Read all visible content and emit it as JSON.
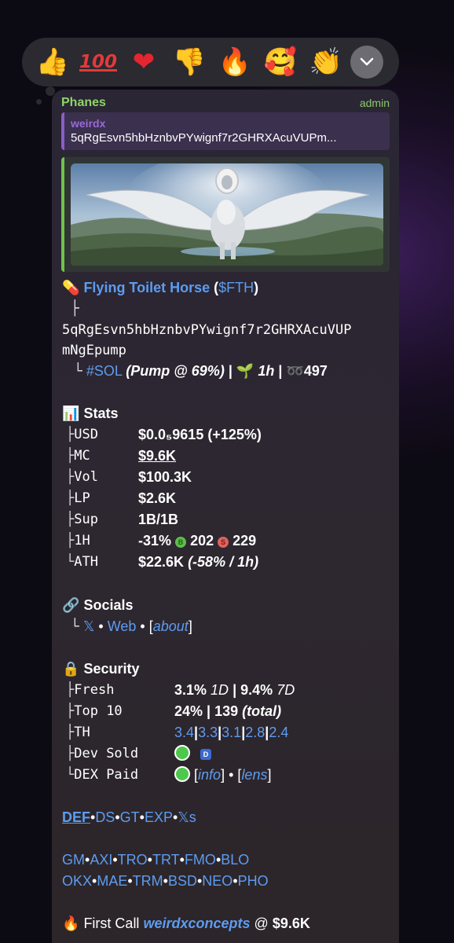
{
  "reactions": {
    "items": [
      {
        "icon": "thumbs-up-icon",
        "glyph": "👍"
      },
      {
        "icon": "hundred-points-icon",
        "glyph": "100"
      },
      {
        "icon": "red-heart-icon",
        "glyph": "❤"
      },
      {
        "icon": "thumbs-down-icon",
        "glyph": "👎"
      },
      {
        "icon": "fire-icon",
        "glyph": "🔥"
      },
      {
        "icon": "smiling-hearts-icon",
        "glyph": "🥰"
      },
      {
        "icon": "clapping-hands-icon",
        "glyph": "👏"
      }
    ]
  },
  "message": {
    "sender": "Phanes",
    "role": "admin",
    "reply": {
      "name": "weirdx",
      "text": "5qRgEsvn5hbHznbvPYwignf7r2GHRXAcuVUPm..."
    },
    "token": {
      "emoji": "💊",
      "name": "Flying Toilet Horse",
      "open_paren": "(",
      "ticker": "$FTH",
      "close_paren": ")",
      "tree_top": "├",
      "address_line1": "5qRgEsvn5hbHznbvPYwignf7r2GHRXAcuVUP",
      "address_line2": "mNgEpump",
      "tree_end": "└",
      "chain": "#SOL",
      "pump": "(Pump @ 69%)",
      "sep1": "|",
      "seedling": "🌱",
      "age": "1h",
      "sep2": "|",
      "holders_icon": "➿",
      "holders": "497"
    },
    "stats": {
      "emoji": "📊",
      "title": "Stats",
      "rows": [
        {
          "tree": "├",
          "label": "USD",
          "value": "$0.0₅9615 (+125%)"
        },
        {
          "tree": "├",
          "label": "MC",
          "value": "$9.6K"
        },
        {
          "tree": "├",
          "label": "Vol",
          "value": "$100.3K"
        },
        {
          "tree": "├",
          "label": "LP",
          "value": "$2.6K"
        },
        {
          "tree": "├",
          "label": "Sup",
          "value": "1B/1B"
        },
        {
          "tree": "├",
          "label": "1H",
          "value": "-31%",
          "buy_badge": "B",
          "buys": "202",
          "sell_badge": "S",
          "sells": "229"
        },
        {
          "tree": "└",
          "label": "ATH",
          "value": "$22.6K",
          "extra": "(-58% / 1h)"
        }
      ]
    },
    "socials": {
      "emoji": "🔗",
      "title": "Socials",
      "tree": "└",
      "x": "𝕏",
      "dot1": "•",
      "web": "Web",
      "dot2": "•",
      "about_open": "[",
      "about": "about",
      "about_close": "]"
    },
    "security": {
      "emoji": "🔒",
      "title": "Security",
      "fresh": {
        "tree": "├",
        "label": "Fresh",
        "p1": "3.1%",
        "t1": "1D",
        "sep": "|",
        "p2": "9.4%",
        "t2": "7D"
      },
      "top10": {
        "tree": "├",
        "label": "Top 10",
        "p": "24%",
        "sep": "|",
        "count": "139",
        "total": "(total)"
      },
      "th": {
        "tree": "├",
        "label": "TH",
        "values": [
          "3.4",
          "3.3",
          "3.1",
          "2.8",
          "2.4"
        ],
        "sep": "|"
      },
      "dev": {
        "tree": "├",
        "label": "Dev Sold",
        "badge": "D"
      },
      "dex": {
        "tree": "└",
        "label": "DEX Paid",
        "info_open": "[",
        "info": "info",
        "info_close": "]",
        "dot": "•",
        "lens_open": "[",
        "lens": "lens",
        "lens_close": "]"
      }
    },
    "links_row1": [
      "DEF",
      "DS",
      "GT",
      "EXP",
      "𝕏s"
    ],
    "links_row2": [
      "GM",
      "AXI",
      "TRO",
      "TRT",
      "FMO",
      "BLO"
    ],
    "links_row3": [
      "OKX",
      "MAE",
      "TRM",
      "BSD",
      "NEO",
      "PHO"
    ],
    "link_sep": "•",
    "first_call": {
      "emoji": "🔥",
      "text": "First Call",
      "user": "weirdxconcepts",
      "at": "@",
      "value": "$9.6K"
    }
  },
  "colors": {
    "link": "#5d9cf0",
    "sender": "#8fd46a",
    "reply_accent": "#8a5ec9",
    "media_accent": "#6fc34c",
    "green_check": "#4cc84a"
  }
}
